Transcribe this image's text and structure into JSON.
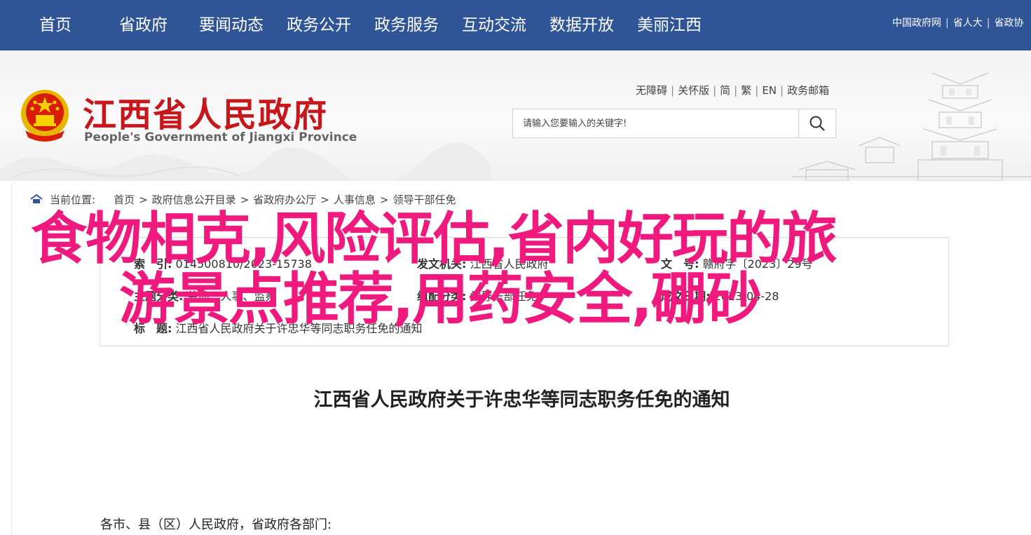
{
  "top_nav": {
    "items": [
      "首页",
      "省政府",
      "要闻动态",
      "政务公开",
      "政务服务",
      "互动交流",
      "数据开放",
      "美丽江西"
    ],
    "links": [
      "中国政府网",
      "省人大",
      "省政协"
    ]
  },
  "header": {
    "title": "江西省人民政府",
    "subtitle": "People's Government of Jiangxi Province",
    "utility": [
      "无障碍",
      "关怀版",
      "简",
      "繁",
      "EN",
      "政务邮箱"
    ],
    "search_placeholder": "请输入您要输入的关键字!"
  },
  "breadcrumb": {
    "label": "当前位置:",
    "items": [
      "首页",
      "政府信息公开目录",
      "省政府办公厅",
      "人事信息",
      "领导干部任免"
    ],
    "separator": ">"
  },
  "meta": {
    "index_key": "索　引:",
    "index_val": "014500810/2023-15738",
    "publisher_key": "发文机关:",
    "publisher_val": "江西省人民政府",
    "docno_key": "文　号:",
    "docno_val": "赣府字〔2023〕29号",
    "topic_key": "主题分类:",
    "topic_val": "劳动、人事、监察",
    "genre_key": "组配分类:",
    "genre_val": "领导干部任免",
    "date_key": "成文日期:",
    "date_val": "2023-04-28",
    "subject_key": "标　题:",
    "subject_val": "江西省人民政府关于许忠华等同志职务任免的通知"
  },
  "document": {
    "title": "江西省人民政府关于许忠华等同志职务任免的通知",
    "salutation": "各市、县（区）人民政府，省政府各部门:"
  },
  "overlay": {
    "line1": "食物相克,风险评估,省内好玩的旅",
    "line2": "游景点推荐,用药安全,硼砂"
  },
  "colors": {
    "nav_bg": "#2f5597",
    "title_red": "#c8161d",
    "overlay_pink": "#f0197d"
  }
}
